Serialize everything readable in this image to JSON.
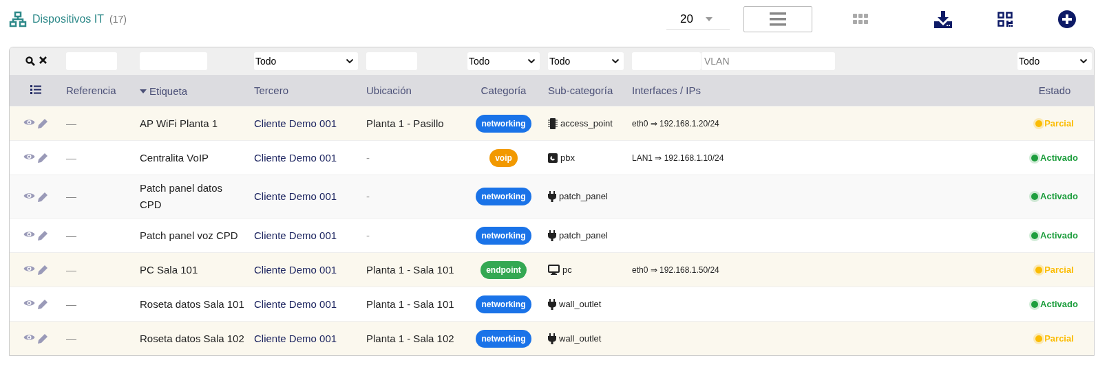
{
  "header": {
    "title": "Dispositivos IT",
    "count": "(17)",
    "page_size": "20",
    "views": [
      {
        "kind": "list",
        "selected": true
      },
      {
        "kind": "grid",
        "selected": false
      }
    ],
    "actions": [
      {
        "kind": "download"
      },
      {
        "kind": "qr"
      },
      {
        "kind": "add"
      }
    ]
  },
  "filters": [
    {
      "kind": "search"
    },
    {
      "kind": "input"
    },
    {
      "kind": "input"
    },
    {
      "kind": "select",
      "value": "Todo"
    },
    {
      "kind": "input"
    },
    {
      "kind": "select",
      "value": "Todo"
    },
    {
      "kind": "select",
      "value": "Todo"
    },
    {
      "kind": "double",
      "placeholder": "VLAN"
    },
    {
      "kind": "select",
      "value": "Todo"
    }
  ],
  "table": {
    "columns": [
      {
        "kind": "menu"
      },
      {
        "label": "Referencia"
      },
      {
        "label": "Etiqueta",
        "sorted": true
      },
      {
        "label": "Tercero"
      },
      {
        "label": "Ubicación"
      },
      {
        "label": "Categoría"
      },
      {
        "label": "Sub-categoría"
      },
      {
        "label": "Interfaces / IPs"
      },
      {
        "label": "Estado"
      }
    ],
    "rows": [
      {
        "reference": "—",
        "label": "AP WiFi Planta 1",
        "third_party": "Cliente Demo 001",
        "location": "Planta 1 - Pasillo",
        "category": {
          "label": "networking",
          "color": "#1a73e8"
        },
        "subcategory": {
          "kind": "chip",
          "label": "access_point"
        },
        "interfaces": "eth0 ⇒ 192.168.1.20/24",
        "status": {
          "kind": "partial",
          "label": "Parcial"
        }
      },
      {
        "reference": "—",
        "label": "Centralita VoIP",
        "third_party": "Cliente Demo 001",
        "location": "-",
        "category": {
          "label": "voip",
          "color": "#f29900"
        },
        "subcategory": {
          "kind": "phone",
          "label": "pbx"
        },
        "interfaces": "LAN1 ⇒ 192.168.1.10/24",
        "status": {
          "kind": "active",
          "label": "Activado"
        }
      },
      {
        "reference": "—",
        "label": "Patch panel datos CPD",
        "third_party": "Cliente Demo 001",
        "location": "-",
        "category": {
          "label": "networking",
          "color": "#1a73e8"
        },
        "subcategory": {
          "kind": "plug",
          "label": "patch_panel"
        },
        "status": {
          "kind": "active",
          "label": "Activado"
        }
      },
      {
        "reference": "—",
        "label": "Patch panel voz CPD",
        "third_party": "Cliente Demo 001",
        "location": "-",
        "category": {
          "label": "networking",
          "color": "#1a73e8"
        },
        "subcategory": {
          "kind": "plug",
          "label": "patch_panel"
        },
        "status": {
          "kind": "active",
          "label": "Activado"
        }
      },
      {
        "reference": "—",
        "label": "PC Sala 101",
        "third_party": "Cliente Demo 001",
        "location": "Planta 1 - Sala 101",
        "category": {
          "label": "endpoint",
          "color": "#34a853"
        },
        "subcategory": {
          "kind": "monitor",
          "label": "pc"
        },
        "interfaces": "eth0 ⇒ 192.168.1.50/24",
        "status": {
          "kind": "partial",
          "label": "Parcial"
        }
      },
      {
        "reference": "—",
        "label": "Roseta datos Sala 101",
        "third_party": "Cliente Demo 001",
        "location": "Planta 1 - Sala 101",
        "category": {
          "label": "networking",
          "color": "#1a73e8"
        },
        "subcategory": {
          "kind": "plug",
          "label": "wall_outlet"
        },
        "status": {
          "kind": "active",
          "label": "Activado"
        }
      },
      {
        "reference": "—",
        "label": "Roseta datos Sala 102",
        "third_party": "Cliente Demo 001",
        "location": "Planta 1 - Sala 102",
        "category": {
          "label": "networking",
          "color": "#1a73e8"
        },
        "subcategory": {
          "kind": "plug",
          "label": "wall_outlet"
        },
        "status": {
          "kind": "partial",
          "label": "Parcial"
        }
      }
    ]
  }
}
